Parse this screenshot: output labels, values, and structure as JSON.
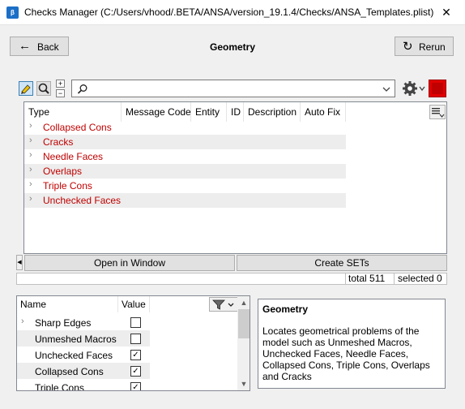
{
  "window": {
    "title": "Checks Manager (C:/Users/vhood/.BETA/ANSA/version_19.1.4/Checks/ANSA_Templates.plist)",
    "app_icon_text": "β",
    "close_label": "✕"
  },
  "header": {
    "back_label": "Back",
    "page_title": "Geometry",
    "rerun_label": "Rerun"
  },
  "toolbar": {
    "search_value": "",
    "plus_label": "+",
    "minus_label": "−",
    "accent_color": "#e00000"
  },
  "checks_table": {
    "columns": [
      "Type",
      "Message Code",
      "Entity",
      "ID",
      "Description",
      "Auto Fix"
    ],
    "rows": [
      {
        "label": "Collapsed Cons"
      },
      {
        "label": "Cracks"
      },
      {
        "label": "Needle Faces"
      },
      {
        "label": "Overlaps"
      },
      {
        "label": "Triple Cons"
      },
      {
        "label": "Unchecked Faces"
      }
    ],
    "row_text_color": "#c00000"
  },
  "actions": {
    "open_window_label": "Open in Window",
    "create_sets_label": "Create SETs"
  },
  "status": {
    "total_label": "total 511",
    "selected_label": "selected 0"
  },
  "properties": {
    "columns": [
      "Name",
      "Value"
    ],
    "rows": [
      {
        "label": "Sharp Edges",
        "checked": false,
        "expandable": true
      },
      {
        "label": "Unmeshed Macros",
        "checked": false,
        "expandable": false
      },
      {
        "label": "Unchecked Faces",
        "checked": true,
        "expandable": false
      },
      {
        "label": "Collapsed Cons",
        "checked": true,
        "expandable": false
      },
      {
        "label": "Triple Cons",
        "checked": true,
        "expandable": false
      }
    ]
  },
  "description": {
    "title": "Geometry",
    "text": "Locates geometrical problems of the model such as Unmeshed Macros, Unchecked Faces, Needle Faces, Collapsed Cons, Triple Cons, Overlaps and Cracks"
  }
}
